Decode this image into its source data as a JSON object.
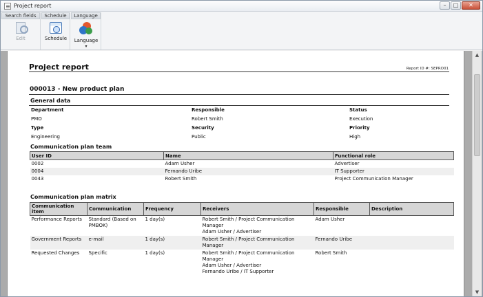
{
  "window": {
    "title": "Project report",
    "controls": {
      "minimize": "–",
      "maximize": "□",
      "close": "✕"
    }
  },
  "ribbon": {
    "groups": [
      {
        "title": "Search fields",
        "button": {
          "label": "Edit",
          "icon": "edit-icon",
          "enabled": false
        }
      },
      {
        "title": "Schedule",
        "button": {
          "label": "Schedule",
          "icon": "schedule-icon",
          "enabled": true
        }
      },
      {
        "title": "Language",
        "button": {
          "label": "Language",
          "icon": "language-icon",
          "enabled": true,
          "dropdown": "▾"
        }
      }
    ]
  },
  "report": {
    "title": "Project report",
    "report_id": "Report ID #: SEPRO01",
    "project_title": "000013 - New product plan",
    "general": {
      "heading": "General data",
      "fields": [
        {
          "label": "Department",
          "value": "PMO"
        },
        {
          "label": "Responsible",
          "value": "Robert Smith"
        },
        {
          "label": "Status",
          "value": "Execution"
        },
        {
          "label": "Type",
          "value": "Engineering"
        },
        {
          "label": "Security",
          "value": "Public"
        },
        {
          "label": "Priority",
          "value": "High"
        }
      ]
    },
    "team": {
      "heading": "Communication plan team",
      "columns": [
        "User ID",
        "Name",
        "Functional role"
      ],
      "rows": [
        [
          "0002",
          "Adam Usher",
          "Advertiser"
        ],
        [
          "0004",
          "Fernando Uribe",
          "IT Supporter"
        ],
        [
          "0043",
          "Robert Smith",
          "Project Communication Manager"
        ]
      ]
    },
    "matrix": {
      "heading": "Communication plan matrix",
      "columns": [
        "Communication item",
        "Communication",
        "Frequency",
        "Receivers",
        "Responsible",
        "Description"
      ],
      "rows": [
        {
          "item": "Performance Reports",
          "communication": [
            "Standard (Based on",
            "PMBOK)"
          ],
          "frequency": "1 day(s)",
          "receivers": [
            "Robert Smith / Project Communication",
            "Manager",
            "Adam Usher / Advertiser"
          ],
          "responsible": "Adam Usher",
          "description": ""
        },
        {
          "item": "Government Reports",
          "communication": [
            "e-mail"
          ],
          "frequency": "1 day(s)",
          "receivers": [
            "Robert Smith / Project Communication",
            "Manager"
          ],
          "responsible": "Fernando Uribe",
          "description": ""
        },
        {
          "item": "Requested Changes",
          "communication": [
            "Specific"
          ],
          "frequency": "1 day(s)",
          "receivers": [
            "Robert Smith / Project Communication",
            "Manager",
            "Adam Usher / Advertiser",
            "Fernando Uribe / IT Supporter"
          ],
          "responsible": "Robert Smith",
          "description": ""
        }
      ]
    }
  },
  "scrollbar": {
    "up": "▲",
    "down": "▼"
  }
}
